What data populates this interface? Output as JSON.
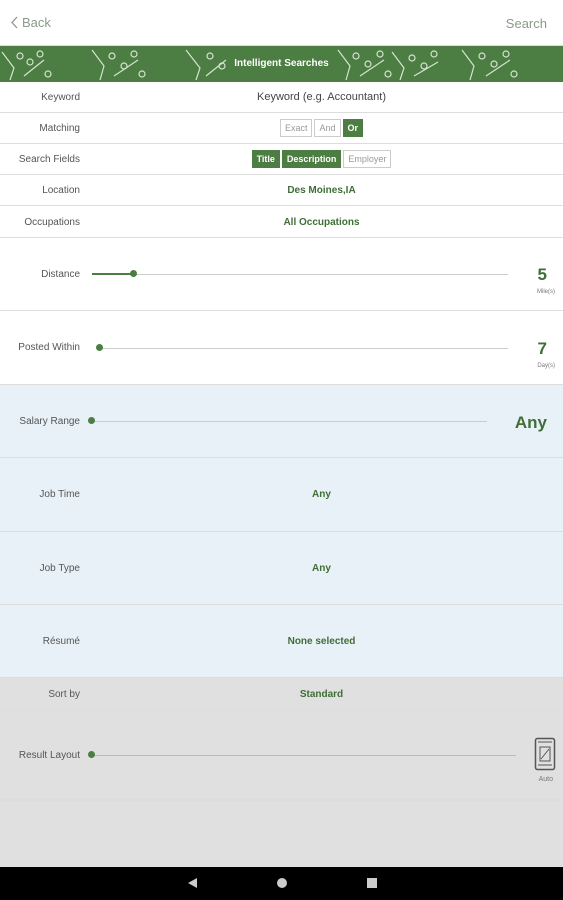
{
  "header": {
    "back_label": "Back",
    "search_label": "Search"
  },
  "banner": {
    "title": "Intelligent Searches"
  },
  "keyword": {
    "label": "Keyword",
    "value": "Keyword (e.g. Accountant)"
  },
  "matching": {
    "label": "Matching",
    "options": [
      "Exact",
      "And",
      "Or"
    ],
    "selected": "Or"
  },
  "search_fields": {
    "label": "Search Fields",
    "options": [
      "Title",
      "Description",
      "Employer"
    ],
    "selected": [
      "Title",
      "Description"
    ]
  },
  "location": {
    "label": "Location",
    "value": "Des Moines,IA"
  },
  "occupations": {
    "label": "Occupations",
    "value": "All Occupations"
  },
  "distance": {
    "label": "Distance",
    "value": "5",
    "unit": "Mile(s)",
    "level": 0.1
  },
  "posted_within": {
    "label": "Posted Within",
    "value": "7",
    "unit": "Day(s)",
    "level": 0.02
  },
  "salary_range": {
    "label": "Salary Range",
    "value": "Any",
    "level": 0
  },
  "job_time": {
    "label": "Job Time",
    "value": "Any"
  },
  "job_type": {
    "label": "Job Type",
    "value": "Any"
  },
  "resume": {
    "label": "Résumé",
    "value": "None selected"
  },
  "sort_by": {
    "label": "Sort by",
    "value": "Standard"
  },
  "result_layout": {
    "label": "Result Layout",
    "value": "Auto",
    "icon": "phone-layout-icon"
  },
  "colors": {
    "brand_green": "#4c7d42",
    "light_blue": "#e8f1f8",
    "grey": "#e0e0e0"
  },
  "nav": {
    "icons": [
      "back-triangle-icon",
      "home-circle-icon",
      "recents-square-icon"
    ]
  }
}
